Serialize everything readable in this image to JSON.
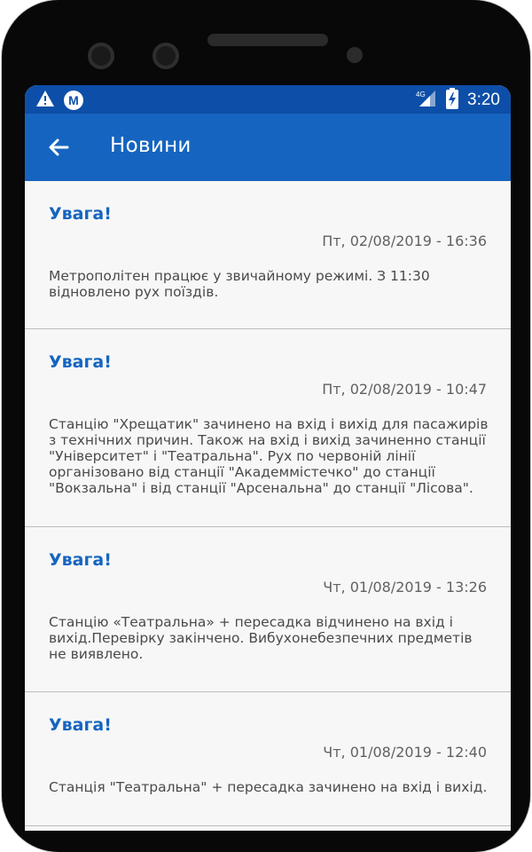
{
  "status_bar": {
    "time": "3:20",
    "network": "4G",
    "icons": [
      "warning-icon",
      "metro-logo-icon",
      "signal-icon",
      "battery-charging-icon"
    ]
  },
  "app_bar": {
    "title": "Новини",
    "back_icon": "arrow-left-icon"
  },
  "news": [
    {
      "title": "Увага!",
      "date": "Пт, 02/08/2019 - 16:36",
      "text": "Метрополітен працює у звичайному режимі. З 11:30 відновлено рух поїздів."
    },
    {
      "title": "Увага!",
      "date": "Пт, 02/08/2019 - 10:47",
      "text": "Станцію \"Хрещатик\" зачинено на вхід і вихід для пасажирів з технічних причин. Також на вхід і вихід зачиненно станції \"Університет\" і \"Театральна\". Рух по червоній лінії організовано від станції \"Академмістечко\" до станції \"Вокзальна\" і від станції \"Арсенальна\" до станції \"Лісова\"."
    },
    {
      "title": "Увага!",
      "date": "Чт, 01/08/2019 - 13:26",
      "text": "Станцію «Театральна» + пересадка відчинено на вхід і вихід.Перевірку закінчено. Вибухонебезпечних предметів не виявлено."
    },
    {
      "title": "Увага!",
      "date": "Чт, 01/08/2019 - 12:40",
      "text": "Станція \"Театральна\" + пересадка зачинено на вхід і вихід."
    }
  ],
  "colors": {
    "status_bar": "#0d4fa8",
    "app_bar": "#1565c0",
    "title_text": "#1565c0",
    "background": "#f7f7f7"
  }
}
